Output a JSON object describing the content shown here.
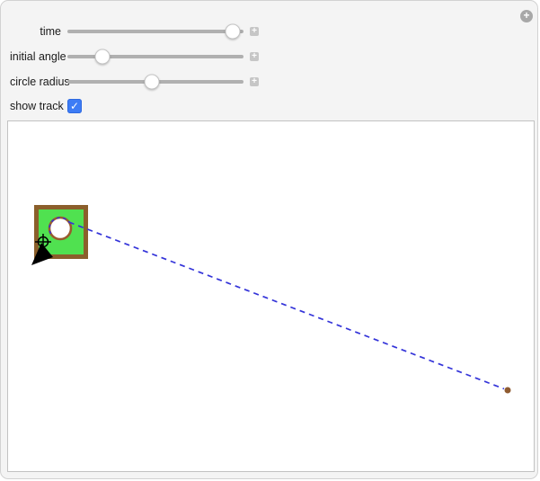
{
  "window": {
    "options_button_glyph": "+"
  },
  "controls": {
    "sliders": [
      {
        "label": "time",
        "thumb_pct": "94%",
        "expander_glyph": "+"
      },
      {
        "label": "initial angle",
        "thumb_pct": "20%",
        "expander_glyph": "+"
      },
      {
        "label": "circle radius",
        "thumb_pct": "48%",
        "expander_glyph": "+"
      }
    ],
    "checkbox": {
      "label": "show track",
      "checked": "true",
      "check_glyph": "✓"
    }
  },
  "colors": {
    "panel_bg": "#f4f4f4",
    "slider_track_gray": "#b0b0b0",
    "checkbox_blue": "#3d7cf5"
  },
  "canvas": {
    "square_fill": "#50e150",
    "square_border": "#8b5f2b",
    "circle_fill": "#ffffff",
    "circle_ring": "#9a5b2d",
    "track_blue": "#3434d9",
    "dot_brown": "#8f5b30",
    "locator_black": "#000000",
    "flag_black": "#000000"
  }
}
